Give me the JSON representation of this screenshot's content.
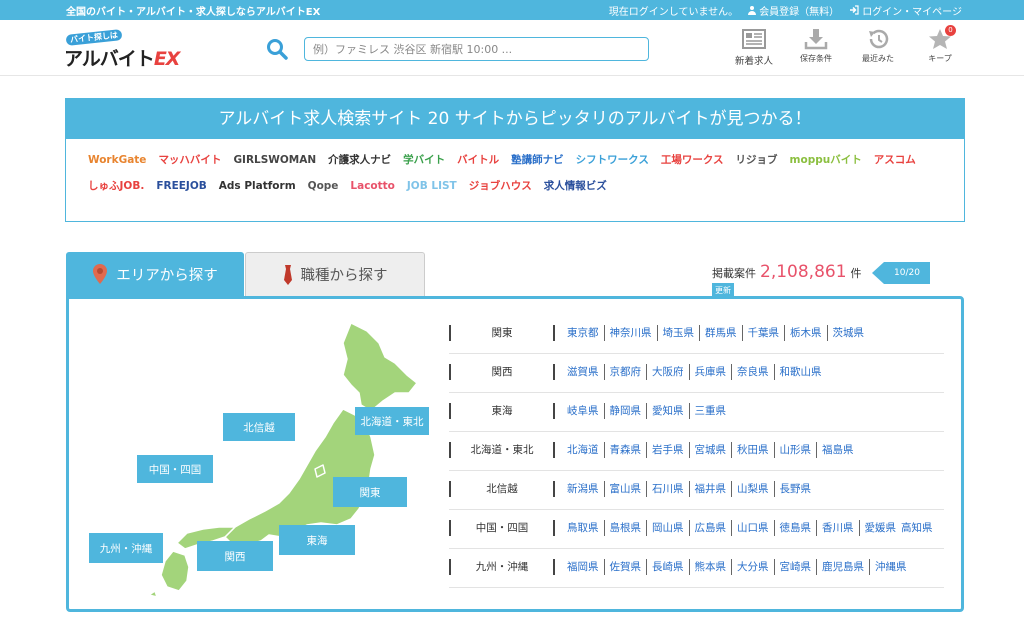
{
  "topbar": {
    "tagline": "全国のバイト・アルバイト・求人探しならアルバイトEX",
    "login_status": "現在ログインしていません。",
    "register_label": "会員登録（無料）",
    "login_label": "ログイン・マイページ"
  },
  "header": {
    "logo_small": "バイト探しは",
    "logo_main": "アルバイト",
    "logo_ex": "EX",
    "search_placeholder": "例）ファミレス 渋谷区 新宿駅 10:00 ...",
    "nav": [
      {
        "label": "新着求人",
        "icon": "newspaper-icon"
      },
      {
        "label": "保存条件",
        "icon": "download-icon"
      },
      {
        "label": "最近みた",
        "icon": "history-icon"
      },
      {
        "label": "キープ",
        "icon": "star-icon",
        "badge": "0"
      }
    ]
  },
  "banner": {
    "title": "アルバイト求人検索サイト 20 サイトからピッタリのアルバイトが見つかる！",
    "brands": [
      {
        "name": "WorkGate",
        "color": "#e8842f"
      },
      {
        "name": "マッハバイト",
        "color": "#e8423f"
      },
      {
        "name": "GIRLSWOMAN",
        "color": "#444444"
      },
      {
        "name": "介護求人ナビ",
        "color": "#333333"
      },
      {
        "name": "学バイト",
        "color": "#3aa04b"
      },
      {
        "name": "バイトル",
        "color": "#e8423f"
      },
      {
        "name": "塾講師ナビ",
        "color": "#2a6fc9"
      },
      {
        "name": "シフトワークス",
        "color": "#3aa0d8"
      },
      {
        "name": "工場ワークス",
        "color": "#e8423f"
      },
      {
        "name": "リジョブ",
        "color": "#555555"
      },
      {
        "name": "moppuバイト",
        "color": "#8bbf3f"
      },
      {
        "name": "アスコム",
        "color": "#e8423f"
      },
      {
        "name": "しゅふJOB.",
        "color": "#e8423f"
      },
      {
        "name": "FREEJOB",
        "color": "#2a4f9c"
      },
      {
        "name": "Ads Platform",
        "color": "#333333"
      },
      {
        "name": "Qope",
        "color": "#555555"
      },
      {
        "name": "Lacotto",
        "color": "#e8526a"
      },
      {
        "name": "JOB LIST",
        "color": "#7fc3e8"
      },
      {
        "name": "ジョブハウス",
        "color": "#e8423f"
      },
      {
        "name": "求人情報ビズ",
        "color": "#2a4f9c"
      }
    ]
  },
  "tabs": {
    "area": "エリアから探す",
    "job": "職種から探す"
  },
  "count": {
    "label": "掲載案件",
    "value": "2,108,861",
    "unit": "件",
    "update_tip": "更新",
    "date": "10/20"
  },
  "map_labels": {
    "hokushinetsu": "北信越",
    "hokkaido_tohoku": "北海道・東北",
    "chugoku_shikoku": "中国・四国",
    "kanto": "関東",
    "tokai": "東海",
    "kyushu_okinawa": "九州・沖縄",
    "kansai": "関西"
  },
  "regions": [
    {
      "name": "関東",
      "prefs": [
        "東京都",
        "神奈川県",
        "埼玉県",
        "群馬県",
        "千葉県",
        "栃木県",
        "茨城県"
      ]
    },
    {
      "name": "関西",
      "prefs": [
        "滋賀県",
        "京都府",
        "大阪府",
        "兵庫県",
        "奈良県",
        "和歌山県"
      ]
    },
    {
      "name": "東海",
      "prefs": [
        "岐阜県",
        "静岡県",
        "愛知県",
        "三重県"
      ]
    },
    {
      "name": "北海道・東北",
      "prefs": [
        "北海道",
        "青森県",
        "岩手県",
        "宮城県",
        "秋田県",
        "山形県",
        "福島県"
      ]
    },
    {
      "name": "北信越",
      "prefs": [
        "新潟県",
        "富山県",
        "石川県",
        "福井県",
        "山梨県",
        "長野県"
      ]
    },
    {
      "name": "中国・四国",
      "prefs": [
        "鳥取県",
        "島根県",
        "岡山県",
        "広島県",
        "山口県",
        "徳島県",
        "香川県",
        "愛媛県",
        "高知県"
      ]
    },
    {
      "name": "九州・沖縄",
      "prefs": [
        "福岡県",
        "佐賀県",
        "長崎県",
        "熊本県",
        "大分県",
        "宮崎県",
        "鹿児島県",
        "沖縄県"
      ]
    }
  ],
  "colors": {
    "accent": "#4fb6dd",
    "map_land": "#a3d47b",
    "link": "#2a6fc9",
    "count": "#e8526a"
  }
}
